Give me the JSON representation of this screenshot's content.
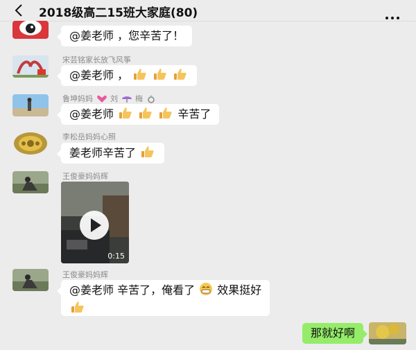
{
  "header": {
    "title": "2018级高二15班大家庭(80)",
    "back_icon": "chevron-left-icon",
    "more_icon": "more-dots-icon"
  },
  "messages": [
    {
      "sender": "",
      "text": "@姜老师 ，您辛苦了！"
    },
    {
      "sender": "宋芸铭家长放飞风筝",
      "text": "@姜老师 ，"
    },
    {
      "sender_a": "鲁坤妈妈",
      "sender_b": "刘",
      "sender_c": "梅",
      "text_a": "@姜老师",
      "text_b": "辛苦了"
    },
    {
      "sender": "李松岳妈妈心照",
      "text": "姜老师辛苦了"
    },
    {
      "sender": "王俊豪妈妈辉",
      "video_duration": "0:15"
    },
    {
      "sender": "王俊豪妈妈辉",
      "text_a": "@姜老师  辛苦了，俺看了",
      "text_b": "效果挺好"
    },
    {
      "text": "那就好啊",
      "self": true
    }
  ],
  "colors": {
    "background": "#ececec",
    "bubble": "#ffffff",
    "self_bubble": "#95ec69"
  }
}
